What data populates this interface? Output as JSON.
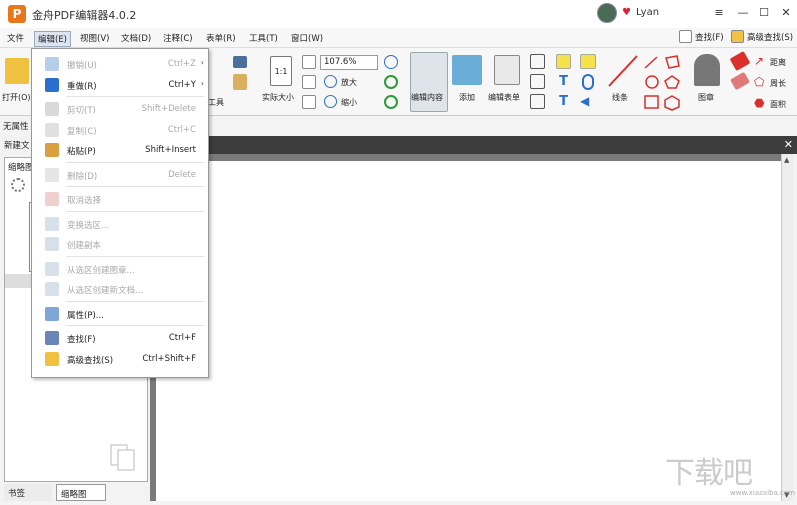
{
  "app": {
    "logo_letter": "P",
    "title": "金舟PDF编辑器4.0.2",
    "user_name": "Lyan",
    "win_minimize": "—",
    "win_maximize": "☐",
    "win_close": "✕",
    "win_menu": "≡"
  },
  "menubar": {
    "items": [
      "文件",
      "编辑(E)",
      "视图(V)",
      "文档(D)",
      "注释(C)",
      "表单(R)",
      "工具(T)",
      "窗口(W)"
    ],
    "active_index": 1,
    "find_label": "查找(F)",
    "advanced_find_label": "高级查找(S)"
  },
  "ribbon": {
    "open_label": "打开(O)",
    "tool_label": "工具",
    "actual_size_label": "实际大小",
    "zoom_value": "107.6%",
    "zoom_in_label": "放大",
    "zoom_out_label": "缩小",
    "edit_content_label": "编辑内容",
    "add_label": "添加",
    "edit_form_label": "编辑表单",
    "line_label": "线条",
    "stamp_label": "图章",
    "distance_label": "距离",
    "perimeter_label": "周长",
    "area_label": "面积"
  },
  "props": {
    "no_props_label": "无属性",
    "new_doc_tab": "新建文"
  },
  "left_panel": {
    "title": "缩略图",
    "bottom_tabs": [
      "书签",
      "缩略图"
    ],
    "active_tab": 1
  },
  "edit_menu": [
    {
      "label": "撤销(U)",
      "shortcut": "Ctrl+Z",
      "disabled": true,
      "submenu": true,
      "icon": "undo-icon"
    },
    {
      "label": "重做(R)",
      "shortcut": "Ctrl+Y",
      "disabled": false,
      "submenu": true,
      "icon": "redo-icon"
    },
    {
      "separator": true
    },
    {
      "label": "剪切(T)",
      "shortcut": "Shift+Delete",
      "disabled": true,
      "icon": "scissors-icon"
    },
    {
      "label": "复制(C)",
      "shortcut": "Ctrl+C",
      "disabled": true,
      "icon": "copy-icon"
    },
    {
      "label": "粘贴(P)",
      "shortcut": "Shift+Insert",
      "disabled": false,
      "icon": "paste-icon"
    },
    {
      "separator": true
    },
    {
      "label": "删除(D)",
      "shortcut": "Delete",
      "disabled": true,
      "icon": "trash-icon"
    },
    {
      "separator": true
    },
    {
      "label": "取消选择",
      "shortcut": "",
      "disabled": true,
      "icon": "deselect-icon"
    },
    {
      "separator": true
    },
    {
      "label": "变换选区...",
      "shortcut": "",
      "disabled": true,
      "icon": "transform-icon"
    },
    {
      "label": "创建副本",
      "shortcut": "",
      "disabled": true,
      "icon": "duplicate-icon"
    },
    {
      "separator": true
    },
    {
      "label": "从选区创建图章...",
      "shortcut": "",
      "disabled": true,
      "icon": "stamp-from-selection-icon"
    },
    {
      "label": "从选区创建新文档...",
      "shortcut": "",
      "disabled": true,
      "icon": "doc-from-selection-icon"
    },
    {
      "separator": true
    },
    {
      "label": "属性(P)...",
      "shortcut": "",
      "disabled": false,
      "icon": "properties-icon"
    },
    {
      "separator": true
    },
    {
      "label": "查找(F)",
      "shortcut": "Ctrl+F",
      "disabled": false,
      "icon": "find-icon"
    },
    {
      "label": "高级查找(S)",
      "shortcut": "Ctrl+Shift+F",
      "disabled": false,
      "icon": "advanced-find-icon"
    }
  ],
  "watermark": {
    "text": "下载吧",
    "sub": "www.xiazaiba.com"
  },
  "colors": {
    "accent_orange": "#e8761a",
    "ribbon_red": "#d9302c",
    "ribbon_blue": "#2a6fcf",
    "ribbon_green": "#2e9b3a"
  }
}
